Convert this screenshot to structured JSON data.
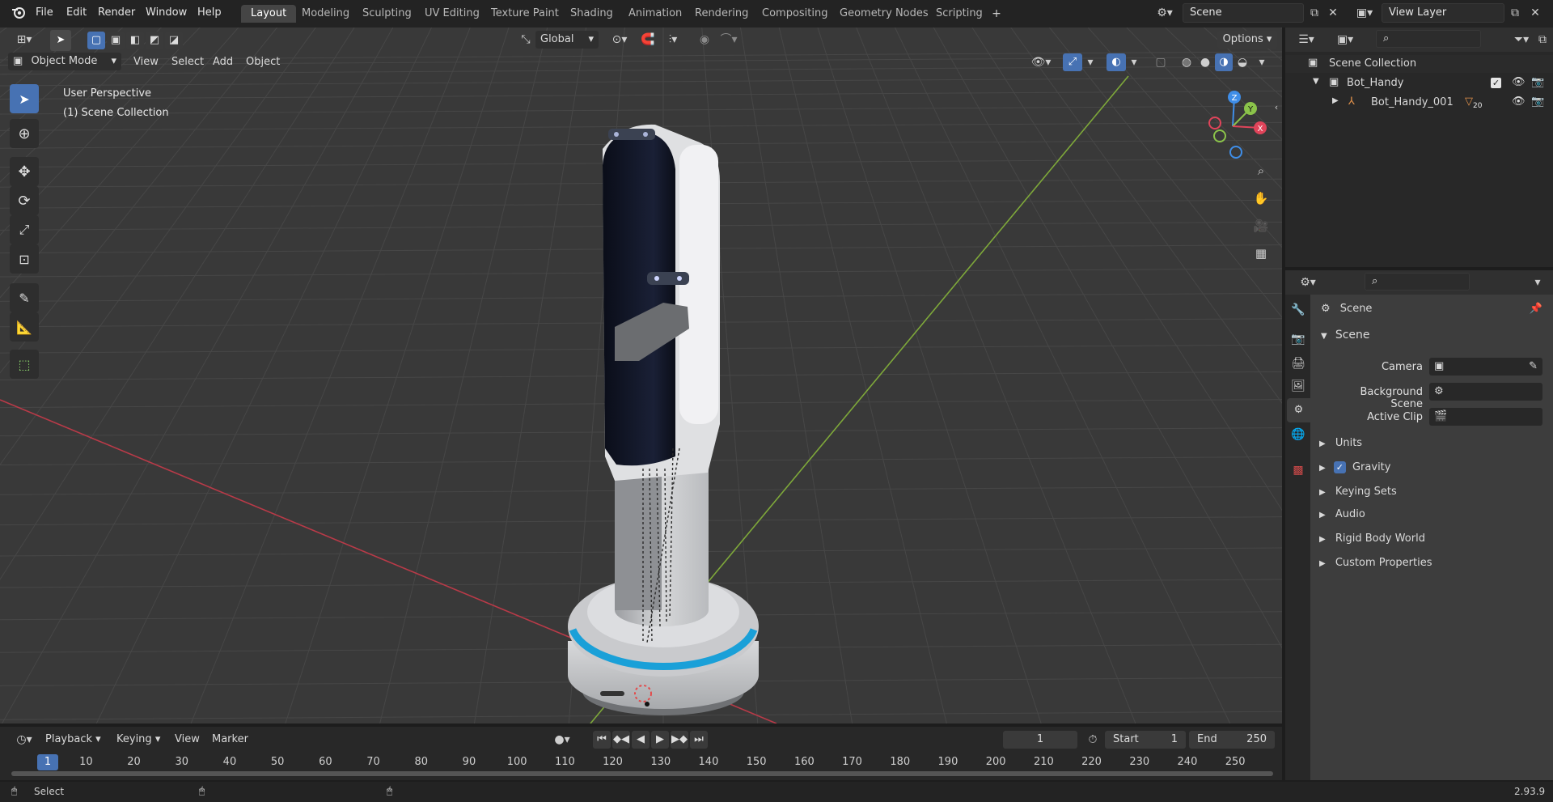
{
  "menu": [
    "File",
    "Edit",
    "Render",
    "Window",
    "Help"
  ],
  "workspaces": [
    "Layout",
    "Modeling",
    "Sculpting",
    "UV Editing",
    "Texture Paint",
    "Shading",
    "Animation",
    "Rendering",
    "Compositing",
    "Geometry Nodes",
    "Scripting"
  ],
  "active_workspace": "Layout",
  "scene_name": "Scene",
  "view_layer": "View Layer",
  "viewport": {
    "mode": "Object Mode",
    "menus": [
      "View",
      "Select",
      "Add",
      "Object"
    ],
    "transform_orientation": "Global",
    "options_label": "Options",
    "perspective_label": "User Perspective",
    "collection_label": "(1) Scene Collection",
    "gizmo_axes": [
      "Z",
      "Y",
      "X"
    ]
  },
  "outliner": {
    "root": "Scene Collection",
    "collection": "Bot_Handy",
    "object": "Bot_Handy_001",
    "object_badge": "20"
  },
  "properties": {
    "header": "Scene",
    "section": "Scene",
    "fields": [
      {
        "label": "Camera"
      },
      {
        "label": "Background Scene"
      },
      {
        "label": "Active Clip"
      }
    ],
    "panels": [
      "Units",
      "Gravity",
      "Keying Sets",
      "Audio",
      "Rigid Body World",
      "Custom Properties"
    ],
    "gravity_checked": true
  },
  "timeline": {
    "menus": [
      "Playback",
      "Keying",
      "View",
      "Marker"
    ],
    "current_frame": "1",
    "start_label": "Start",
    "start": "1",
    "end_label": "End",
    "end": "250",
    "frame_ticks": [
      "1",
      "10",
      "20",
      "30",
      "40",
      "50",
      "60",
      "70",
      "80",
      "90",
      "100",
      "110",
      "120",
      "130",
      "140",
      "150",
      "160",
      "170",
      "180",
      "190",
      "200",
      "210",
      "220",
      "230",
      "240",
      "250"
    ]
  },
  "statusbar": {
    "left_label": "Select",
    "version": "2.93.9"
  },
  "colors": {
    "accent_blue": "#4772b3",
    "active_frame": "#4772b3",
    "x_axis": "#e0445a",
    "y_axis": "#8bc34a",
    "z_axis": "#3f8ee8",
    "robot_ring": "#1aa0d8"
  }
}
